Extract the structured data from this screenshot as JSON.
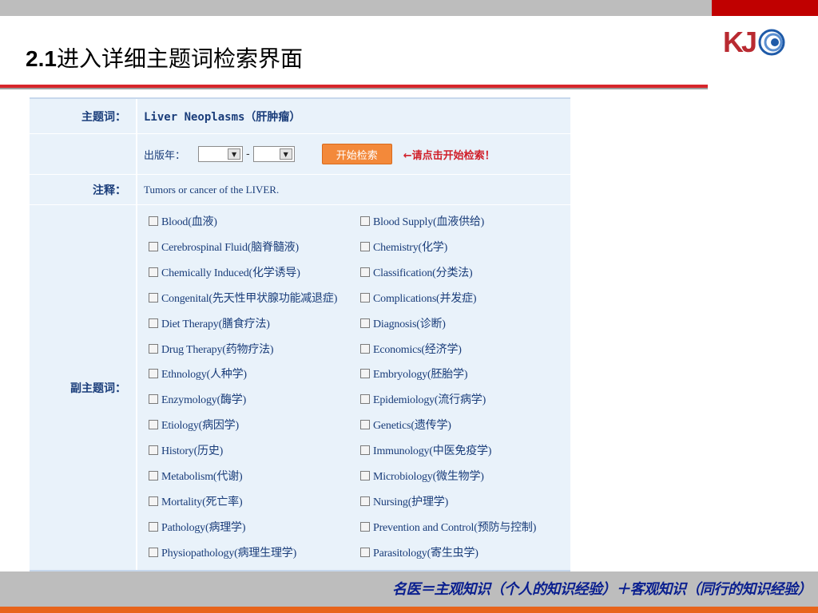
{
  "slide": {
    "title_num": "2.1",
    "title_text": "进入详细主题词检索界面",
    "logo": "KJ",
    "footer": "名医＝主观知识（个人的知识经验）＋客观知识（同行的知识经验）",
    "colors": {
      "red": "#c00000",
      "gray": "#bdbdbd",
      "orange": "#e8641b",
      "footer_text": "#0a1f8f"
    }
  },
  "form": {
    "topic_label": "主题词：",
    "topic_value": "Liver Neoplasms（肝肿瘤）",
    "year_label": "出版年：",
    "year_from": "",
    "year_to": "",
    "year_separator": "-",
    "search_button": "开始检索",
    "hint": "←请点击开始检索！",
    "note_label": "注释：",
    "note_value": "Tumors or cancer of the LIVER.",
    "subheadings_label": "副主题词：",
    "subheadings": [
      [
        "Blood(血液)",
        "Blood Supply(血液供给)"
      ],
      [
        "Cerebrospinal Fluid(脑脊髓液)",
        "Chemistry(化学)"
      ],
      [
        "Chemically Induced(化学诱导)",
        "Classification(分类法)"
      ],
      [
        "Congenital(先天性甲状腺功能减退症)",
        "Complications(并发症)"
      ],
      [
        "Diet Therapy(膳食疗法)",
        "Diagnosis(诊断)"
      ],
      [
        "Drug Therapy(药物疗法)",
        "Economics(经济学)"
      ],
      [
        "Ethnology(人种学)",
        "Embryology(胚胎学)"
      ],
      [
        "Enzymology(酶学)",
        "Epidemiology(流行病学)"
      ],
      [
        "Etiology(病因学)",
        "Genetics(遗传学)"
      ],
      [
        "History(历史)",
        "Immunology(中医免疫学)"
      ],
      [
        "Metabolism(代谢)",
        "Microbiology(微生物学)"
      ],
      [
        "Mortality(死亡率)",
        "Nursing(护理学)"
      ],
      [
        "Pathology(病理学)",
        "Prevention and Control(预防与控制)"
      ],
      [
        "Physiopathology(病理生理学)",
        "Parasitology(寄生虫学)"
      ]
    ]
  }
}
